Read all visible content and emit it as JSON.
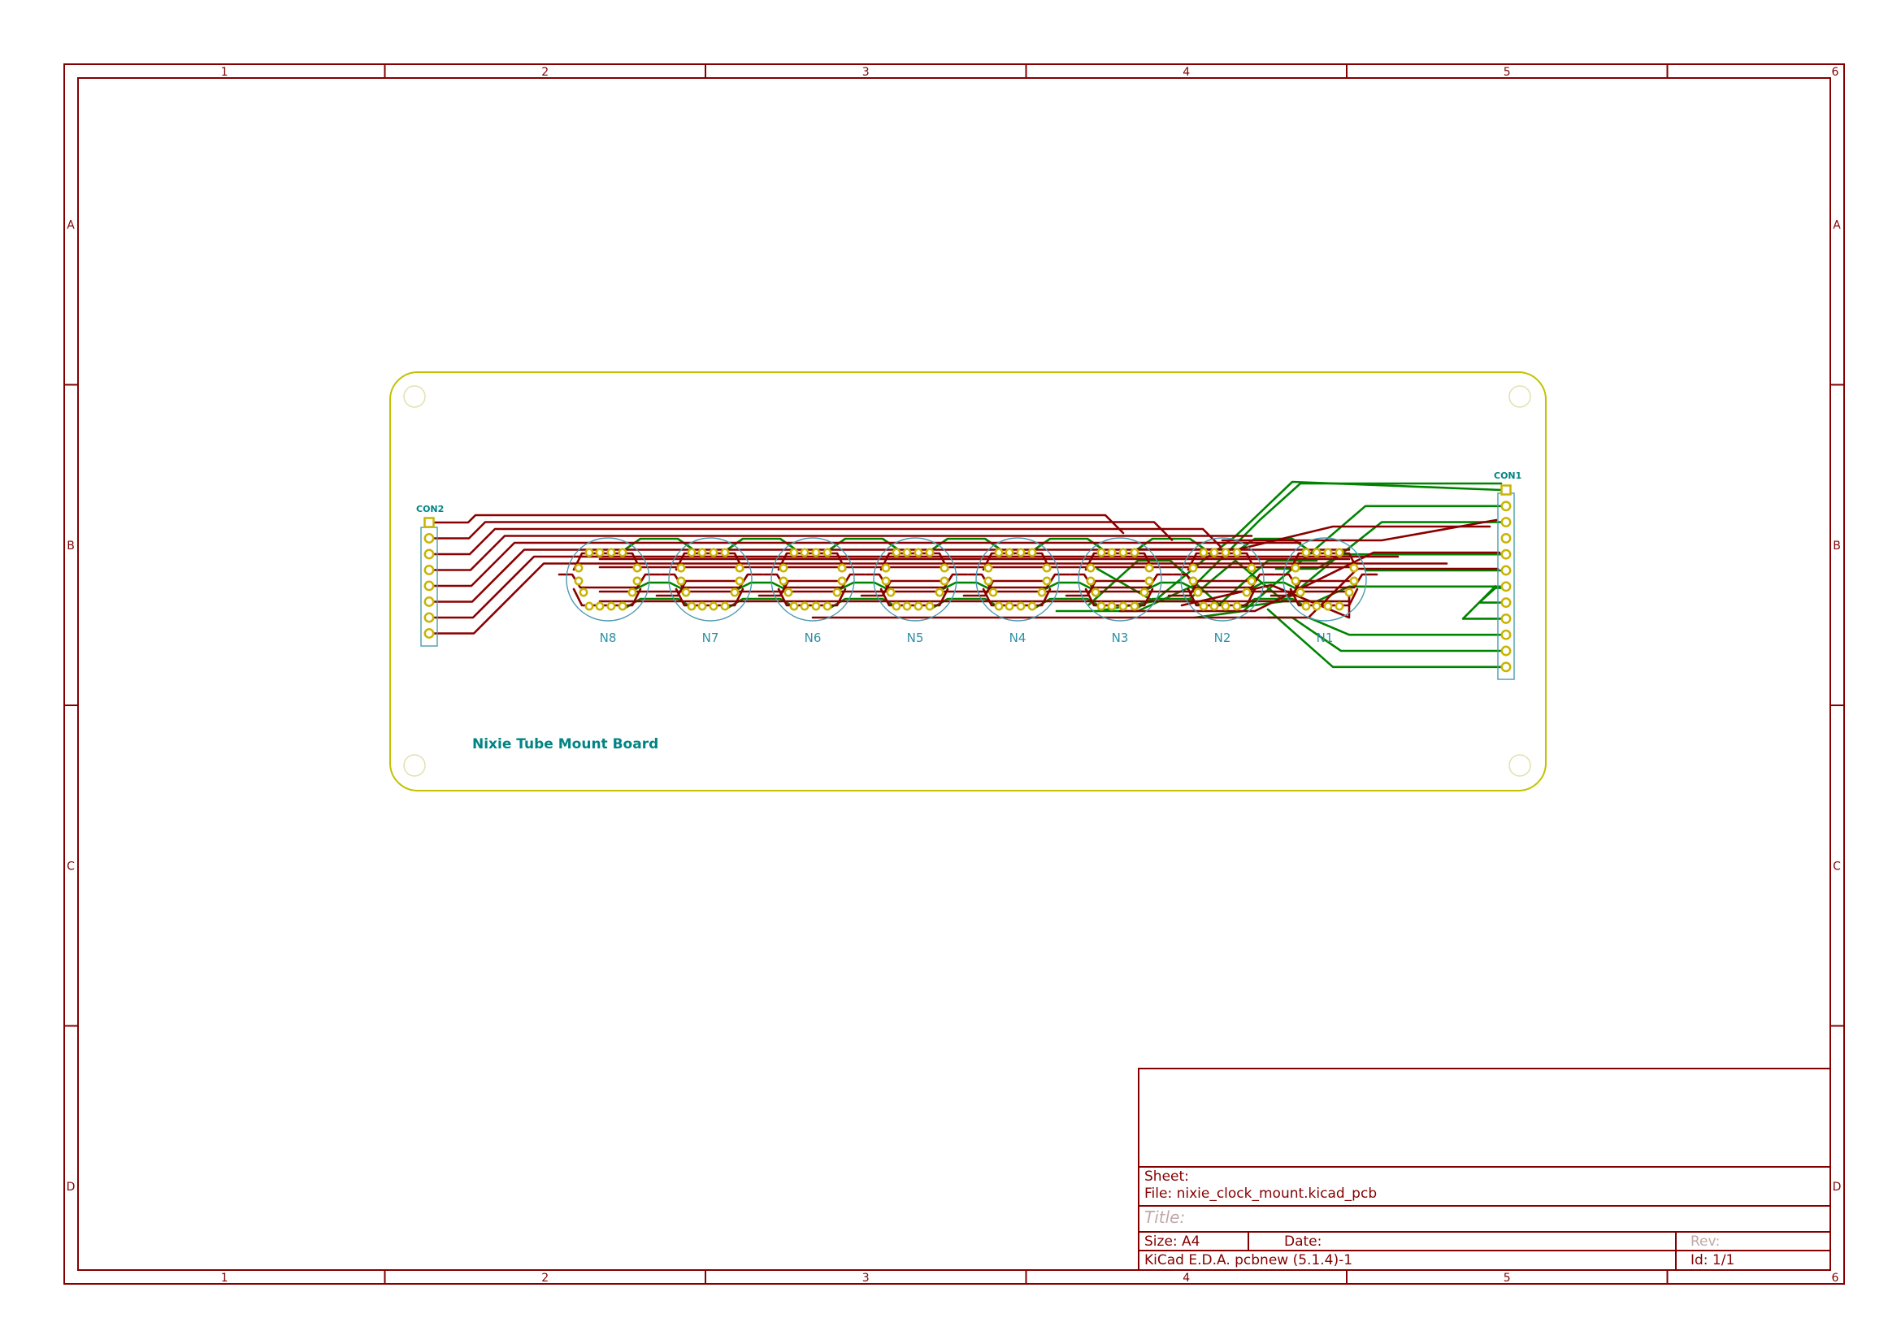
{
  "sheet": {
    "zones": {
      "columns": [
        "1",
        "2",
        "3",
        "4",
        "5",
        "6"
      ],
      "rows": [
        "A",
        "B",
        "C",
        "D"
      ]
    },
    "title_block": {
      "sheet_label": "Sheet:",
      "file_label": "File: nixie_clock_mount.kicad_pcb",
      "title_label": "Title:",
      "size_label": "Size: A4",
      "date_label": "Date:",
      "rev_label": "Rev:",
      "tool_label": "KiCad E.D.A.  pcbnew (5.1.4)-1",
      "id_label": "Id: 1/1"
    }
  },
  "board": {
    "silkscreen_title": "Nixie Tube Mount Board",
    "connectors": [
      {
        "ref": "CON2",
        "pins": 8
      },
      {
        "ref": "CON1",
        "pins": 12
      }
    ],
    "tubes": [
      "N8",
      "N7",
      "N6",
      "N5",
      "N4",
      "N3",
      "N2",
      "N1"
    ],
    "colors": {
      "front_copper": "#8a0000",
      "back_copper": "#008400",
      "edge_cuts": "#c2c200",
      "pads": "#c8b400",
      "footprints": "#4a9ab0",
      "frame": "#840000"
    }
  }
}
